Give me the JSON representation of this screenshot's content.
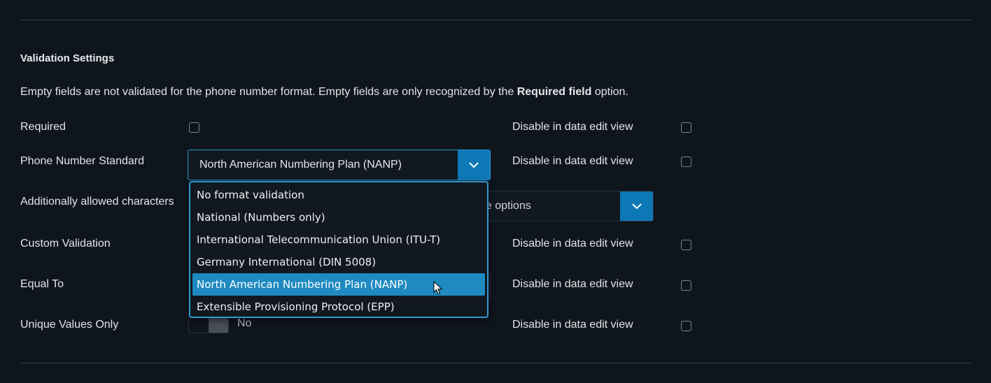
{
  "section": {
    "title": "Validation Settings",
    "description_prefix": "Empty fields are not validated for the phone number format. Empty fields are only recognized by the ",
    "description_bold": "Required field",
    "description_suffix": " option."
  },
  "rows": {
    "required": {
      "label": "Required",
      "disable_label": "Disable in data edit view"
    },
    "phone_standard": {
      "label": "Phone Number Standard",
      "selected": "North American Numbering Plan (NANP)",
      "disable_label": "Disable in data edit view"
    },
    "additional_chars": {
      "label": "Additionally allowed characters",
      "select_value_partial": "ne options"
    },
    "custom_validation": {
      "label": "Custom Validation",
      "disable_label": "Disable in data edit view"
    },
    "equal_to": {
      "label": "Equal To",
      "disable_label": "Disable in data edit view"
    },
    "unique_values": {
      "label": "Unique Values Only",
      "toggle_text": "No",
      "disable_label": "Disable in data edit view"
    }
  },
  "dropdown": {
    "options": [
      "No format validation",
      "National (Numbers only)",
      "International Telecommunication Union (ITU-T)",
      "Germany International (DIN 5008)",
      "North American Numbering Plan (NANP)",
      "Extensible Provisioning Protocol (EPP)"
    ],
    "selected_index": 4
  },
  "colors": {
    "accent": "#0d78b6",
    "highlight": "#1e8ac0",
    "background": "#0f151d"
  },
  "icons": {
    "select_toggle": "chevron-down-icon",
    "cursor": "mouse-pointer-icon"
  }
}
